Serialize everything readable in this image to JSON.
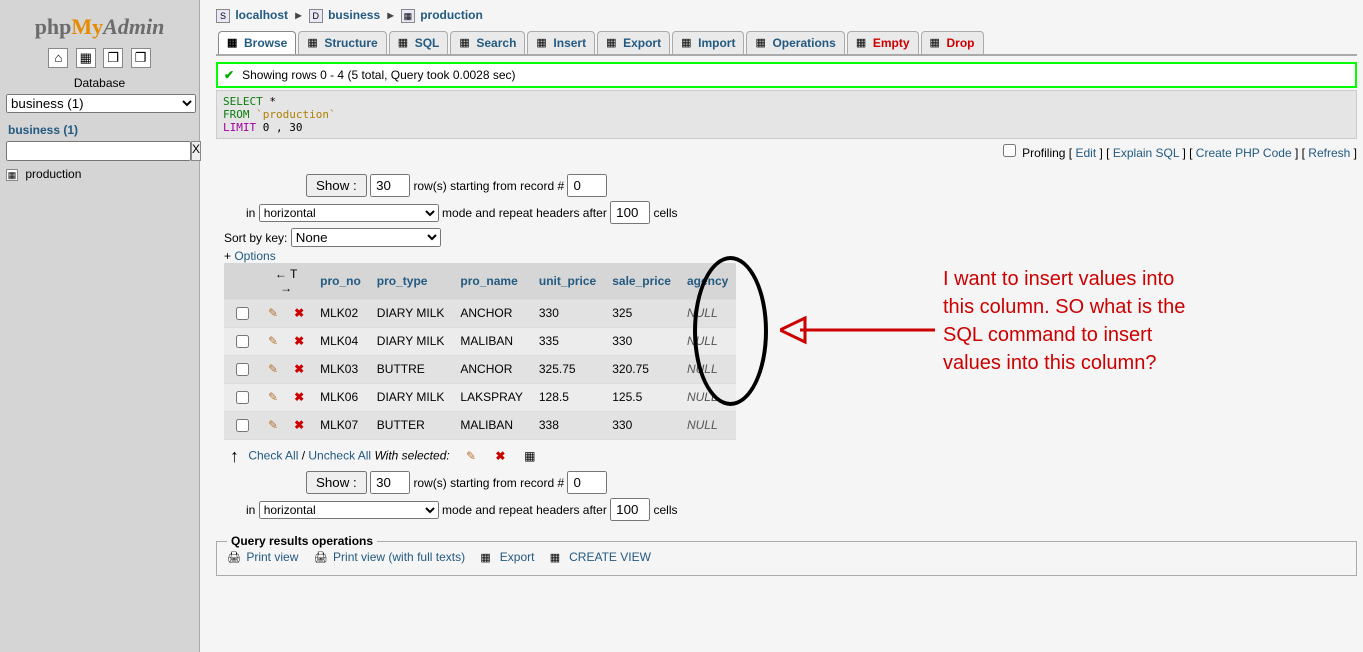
{
  "sidebar": {
    "logo_parts": [
      "php",
      "My",
      "Admin"
    ],
    "database_label": "Database",
    "db_selected": "business (1)",
    "db_link": "business (1)",
    "filter_clear": "X",
    "tables": [
      "production"
    ]
  },
  "breadcrumb": {
    "server": "localhost",
    "database": "business",
    "table": "production"
  },
  "tabs": [
    {
      "label": "Browse",
      "active": true
    },
    {
      "label": "Structure"
    },
    {
      "label": "SQL"
    },
    {
      "label": "Search"
    },
    {
      "label": "Insert"
    },
    {
      "label": "Export"
    },
    {
      "label": "Import"
    },
    {
      "label": "Operations"
    },
    {
      "label": "Empty",
      "danger": true
    },
    {
      "label": "Drop",
      "danger": true
    }
  ],
  "success_msg": "Showing rows 0 - 4 (5 total, Query took 0.0028 sec)",
  "sql_query": {
    "select": "SELECT",
    "star": "*",
    "from": "FROM",
    "table": "`production`",
    "limit": "LIMIT",
    "limit_vals": "0 , 30"
  },
  "result_actions": {
    "profiling": "Profiling",
    "edit": "Edit",
    "explain": "Explain SQL",
    "create_php": "Create PHP Code",
    "refresh": "Refresh"
  },
  "nav1": {
    "show_label": "Show :",
    "rows_val": "30",
    "rows_suffix": "row(s) starting from record #",
    "start_val": "0",
    "in_label": "in",
    "mode_val": "horizontal",
    "mode_suffix": "mode and repeat headers after",
    "repeat_val": "100",
    "cells": "cells",
    "sort_label": "Sort by key:",
    "sort_val": "None",
    "options": "Options"
  },
  "columns": [
    "pro_no",
    "pro_type",
    "pro_name",
    "unit_price",
    "sale_price",
    "agency"
  ],
  "rows": [
    {
      "pro_no": "MLK02",
      "pro_type": "DIARY MILK",
      "pro_name": "ANCHOR",
      "unit_price": "330",
      "sale_price": "325",
      "agency": "NULL"
    },
    {
      "pro_no": "MLK04",
      "pro_type": "DIARY MILK",
      "pro_name": "MALIBAN",
      "unit_price": "335",
      "sale_price": "330",
      "agency": "NULL"
    },
    {
      "pro_no": "MLK03",
      "pro_type": "BUTTRE",
      "pro_name": "ANCHOR",
      "unit_price": "325.75",
      "sale_price": "320.75",
      "agency": "NULL"
    },
    {
      "pro_no": "MLK06",
      "pro_type": "DIARY MILK",
      "pro_name": "LAKSPRAY",
      "unit_price": "128.5",
      "sale_price": "125.5",
      "agency": "NULL"
    },
    {
      "pro_no": "MLK07",
      "pro_type": "BUTTER",
      "pro_name": "MALIBAN",
      "unit_price": "338",
      "sale_price": "330",
      "agency": "NULL"
    }
  ],
  "foot": {
    "check_all": "Check All",
    "uncheck_all": "Uncheck All",
    "with_selected": "With selected:"
  },
  "qops": {
    "legend": "Query results operations",
    "print": "Print view",
    "print_full": "Print view (with full texts)",
    "export": "Export",
    "create_view": "CREATE VIEW"
  },
  "annotation": "I want to insert values into this column. SO what is the SQL command to insert values into this column?"
}
